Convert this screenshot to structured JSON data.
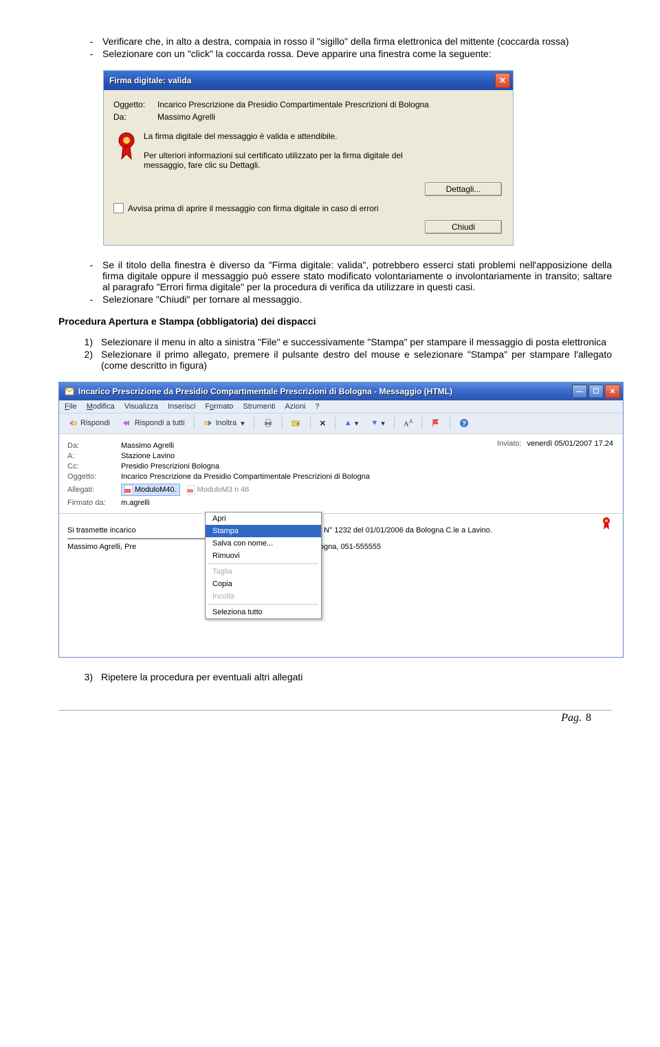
{
  "intro_bullets": [
    "Verificare che, in alto a destra, compaia in rosso il \"sigillo\" della firma elettronica del mittente (coccarda rossa)",
    "Selezionare con un \"click\" la coccarda rossa. Deve apparire una finestra come la seguente:"
  ],
  "dialog1": {
    "title": "Firma digitale: valida",
    "subject_label": "Oggetto:",
    "subject_value": "Incarico Prescrizione da Presidio Compartimentale Prescrizioni di Bologna",
    "from_label": "Da:",
    "from_value": "Massimo Agrelli",
    "msg_line": "La firma digitale del messaggio è valida e attendibile.",
    "info_line1": "Per ulteriori informazioni sul certificato utilizzato per la firma digitale del",
    "info_line2": "messaggio, fare clic su Dettagli.",
    "btn_dettagli": "Dettagli...",
    "chk_label": "Avvisa prima di aprire il messaggio con firma digitale in caso di errori",
    "btn_chiudi": "Chiudi"
  },
  "post_dialog_bullets": [
    "Se il titolo della finestra è diverso da \"Firma digitale: valida\", potrebbero esserci stati problemi nell'apposizione della firma digitale oppure il messaggio può essere stato modificato volontariamente o involontariamente in transito; saltare al paragrafo \"Errori firma digitale\" per la procedura di verifica da utilizzare in questi casi.",
    "Selezionare \"Chiudi\" per tornare al messaggio."
  ],
  "heading_procedura": "Procedura Apertura e Stampa (obbligatoria) dei dispacci",
  "numbered": [
    "Selezionare il menu in alto a sinistra \"File\" e successivamente \"Stampa\" per stampare il messaggio di posta elettronica",
    "Selezionare il primo allegato, premere il pulsante destro del mouse e selezionare \"Stampa\" per stampare l'allegato (come descritto in figura)"
  ],
  "win2": {
    "title": "Incarico Prescrizione da Presidio Compartimentale Prescrizioni di Bologna - Messaggio (HTML)",
    "menu": {
      "file": "File",
      "modifica": "Modifica",
      "visualizza": "Visualizza",
      "inserisci": "Inserisci",
      "formato": "Formato",
      "strumenti": "Strumenti",
      "azioni": "Azioni",
      "help": "?"
    },
    "tb": {
      "rispondi": "Rispondi",
      "rispondi_tutti": "Rispondi a tutti",
      "inoltra": "Inoltra"
    },
    "hdr": {
      "da_label": "Da:",
      "da_val": "Massimo Agrelli",
      "inviato_label": "Inviato:",
      "inviato_val": "venerdì 05/01/2007 17.24",
      "a_label": "A:",
      "a_val": "Stazione Lavino",
      "cc_label": "Cc:",
      "cc_val": "Presidio Prescrizioni Bologna",
      "ogg_label": "Oggetto:",
      "ogg_val": "Incarico Prescrizione da Presidio Compartimentale Prescrizioni di Bologna",
      "all_label": "Allegati:",
      "att1": "ModuloM40.",
      "att2": "ModuloM3 n 46",
      "firm_label": "Firmato da:",
      "firm_val": "m.agrelli"
    },
    "ctx": {
      "apri": "Apri",
      "stampa": "Stampa",
      "salva": "Salva con nome...",
      "rimuovi": "Rimuovi",
      "taglia": "Taglia",
      "copia": "Copia",
      "incolla": "Incolla",
      "seltutto": "Seleziona tutto"
    },
    "body_line1": "Si trasmette incarico",
    "body_line1b": "da allegati, per treno N° 1232 del 01/01/2006 da Bologna C.le a Lavino.",
    "body_sep": "-------------------------------------------------------------------------------------------------------",
    "body_line2a": "Massimo Agrelli, Pre",
    "body_line2b": "e Prescrizioni di Bologna, 051-555555"
  },
  "last_numbered": "Ripetere la procedura per eventuali altri allegati",
  "footer_label": "Pag.",
  "footer_page": "8"
}
